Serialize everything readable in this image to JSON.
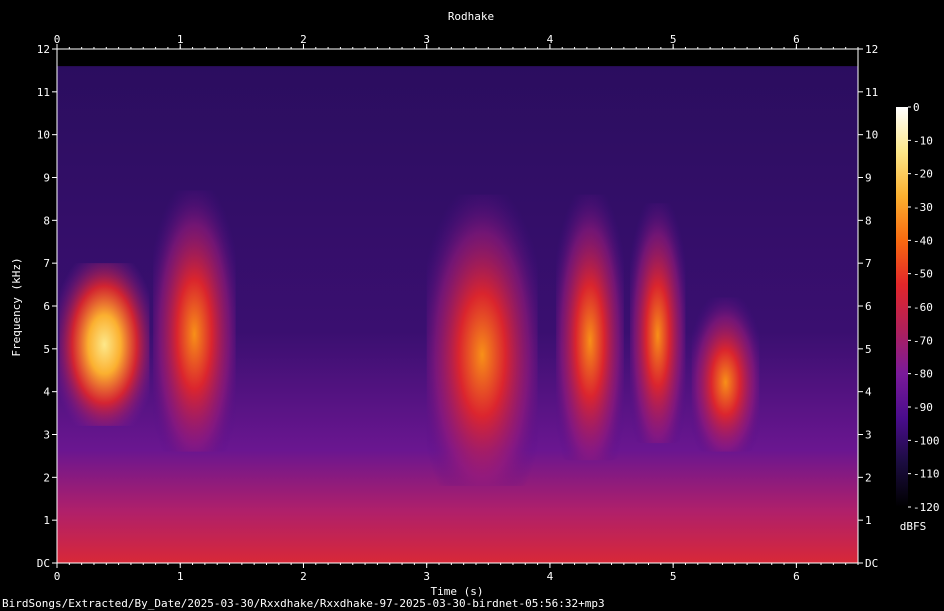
{
  "chart_data": {
    "type": "heatmap",
    "title": "Rodhake",
    "xlabel": "Time (s)",
    "ylabel": "Frequency (kHz)",
    "xlim": [
      0,
      6.5
    ],
    "ylim": [
      0,
      12
    ],
    "x_ticks": [
      "0",
      "1",
      "2",
      "3",
      "4",
      "5",
      "6"
    ],
    "y_ticks": [
      "DC",
      "1",
      "2",
      "3",
      "4",
      "5",
      "6",
      "7",
      "8",
      "9",
      "10",
      "11",
      "12"
    ],
    "colorbar": {
      "label": "dBFS",
      "range": [
        -120,
        0
      ],
      "ticks": [
        "0",
        "-10",
        "-20",
        "-30",
        "-40",
        "-50",
        "-60",
        "-70",
        "-80",
        "-90",
        "-100",
        "-110",
        "-120"
      ],
      "colors": [
        "#000000",
        "#1b0c40",
        "#4a0c8c",
        "#7a1a9a",
        "#b0205a",
        "#e2262a",
        "#f86a10",
        "#fbb030",
        "#fde88a",
        "#ffffff"
      ]
    },
    "calls": [
      {
        "start": 0.02,
        "end": 0.75,
        "fmin": 3.2,
        "fmax": 7.0,
        "peak": -20
      },
      {
        "start": 0.78,
        "end": 1.45,
        "fmin": 2.6,
        "fmax": 8.7,
        "peak": -40
      },
      {
        "start": 3.0,
        "end": 3.9,
        "fmin": 1.8,
        "fmax": 8.6,
        "peak": -40
      },
      {
        "start": 4.05,
        "end": 4.6,
        "fmin": 2.4,
        "fmax": 8.6,
        "peak": -40
      },
      {
        "start": 4.65,
        "end": 5.1,
        "fmin": 2.8,
        "fmax": 8.4,
        "peak": -45
      },
      {
        "start": 5.15,
        "end": 5.7,
        "fmin": 2.6,
        "fmax": 6.2,
        "peak": -45
      }
    ]
  },
  "footer_path": "BirdSongs/Extracted/By_Date/2025-03-30/Rxxdhake/Rxxdhake-97-2025-03-30-birdnet-05:56:32+mp3"
}
